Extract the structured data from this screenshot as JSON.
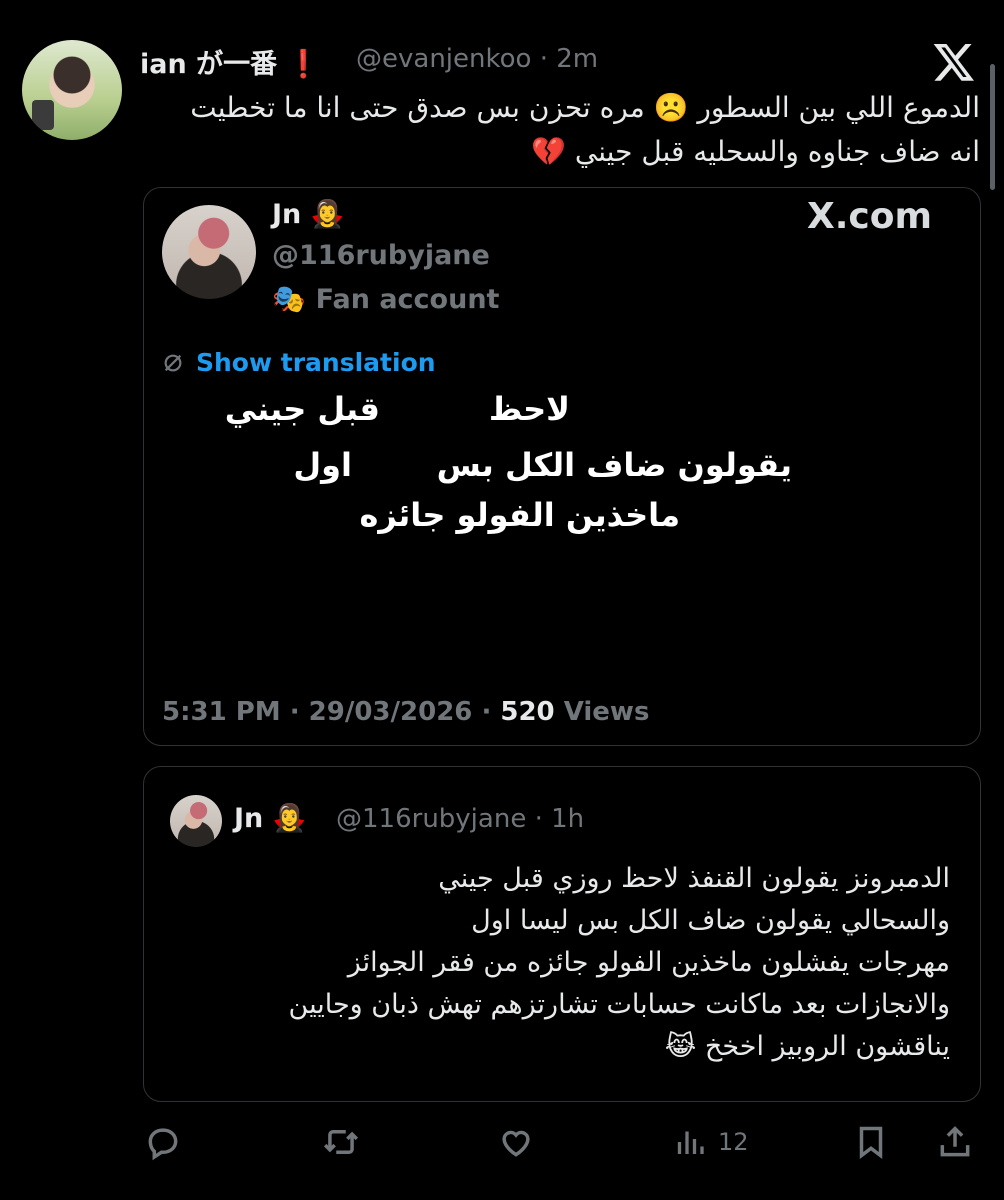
{
  "tweet": {
    "display_name": "ian が一番 ❗",
    "handle": "@evanjenkoo",
    "time": "2m",
    "text_line1": "الدموع اللي بين السطور ☹️ مره تحزن بس صدق حتى انا ما تخطيت",
    "text_line2": "انه ضاف جناوه والسحليه قبل جيني 💔"
  },
  "quote_card": {
    "display_name": "Jn 🧛‍♀️",
    "handle": "@116rubyjane",
    "fan_badge_emoji": "🎭",
    "fan_badge": "Fan account",
    "watermark": "X.com",
    "translate_link": "Show translation",
    "lines": [
      [
        "قبل جيني",
        "لاحظ"
      ],
      [
        "اول",
        "يقولون ضاف الكل بس"
      ],
      [
        "ماخذين الفولو جائزه"
      ]
    ],
    "timestamp": "5:31 PM",
    "date": "29/03/2026",
    "views_count": "520",
    "views_label": "Views"
  },
  "quoted_tweet": {
    "display_name": "Jn 🧛‍♀️",
    "handle": "@116rubyjane",
    "time": "1h",
    "lines": [
      "الدمبرونز يقولون القنفذ لاحظ روزي قبل جيني",
      "والسحالي يقولون ضاف الكل بس ليسا اول",
      "مهرجات يفشلون ماخذين الفولو جائزه من فقر الجوائز",
      "والانجازات بعد ماكانت حسابات تشارتزهم تهش ذبان وجايين",
      "يناقشون الروبيز اخخخ 😹"
    ]
  },
  "actions": {
    "views_count": "12"
  },
  "icons": {
    "logo": "x-logo-icon",
    "reply": "reply-icon",
    "retweet": "retweet-icon",
    "like": "like-icon",
    "views": "views-icon",
    "bookmark": "bookmark-icon",
    "share": "share-icon",
    "translate": "translate-icon"
  },
  "colors": {
    "background": "#000000",
    "text": "#e7e9ea",
    "muted": "#71767b",
    "link": "#1d9bf0",
    "border": "#2f3336"
  }
}
